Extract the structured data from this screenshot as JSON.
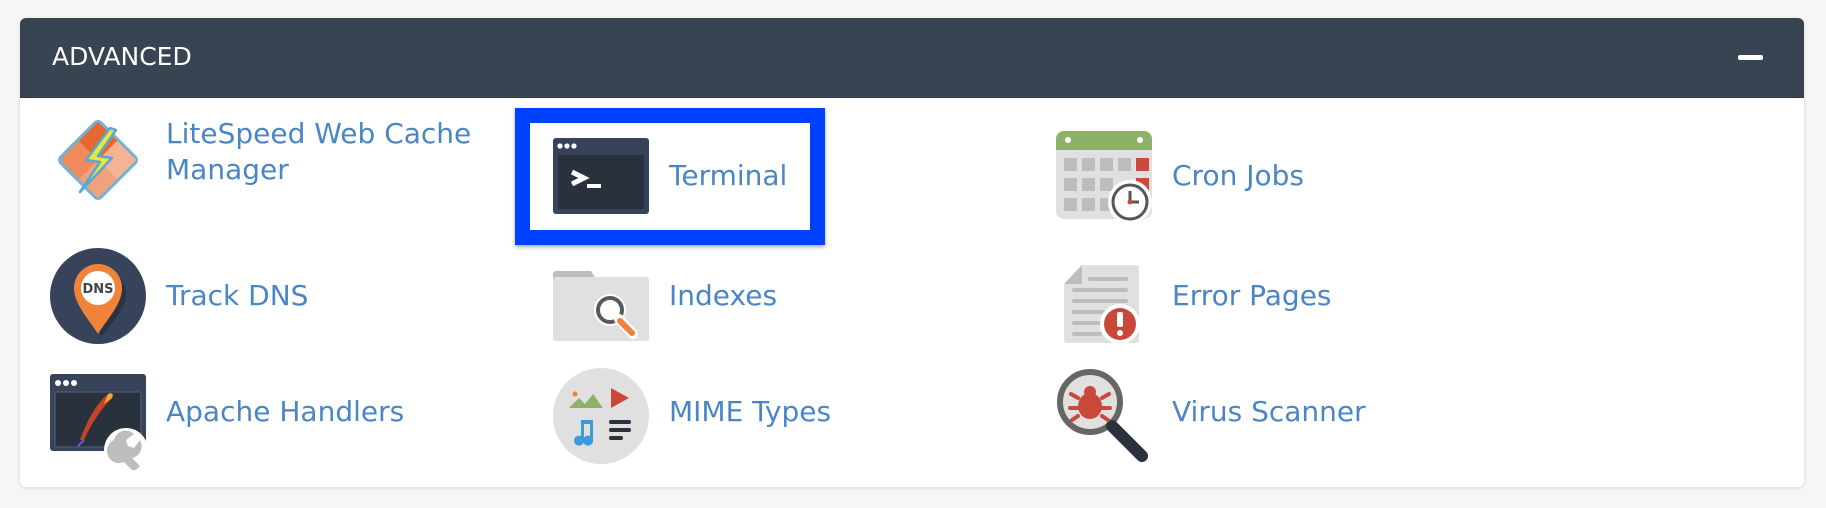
{
  "panel": {
    "title": "ADVANCED",
    "collapse_icon": "minus-icon"
  },
  "highlight": {
    "target": "Terminal",
    "color": "#0041ff"
  },
  "items": [
    {
      "label": "LiteSpeed Web Cache Manager",
      "label_line1": "LiteSpeed Web Cache",
      "label_line2": "Manager",
      "icon": "litespeed-icon"
    },
    {
      "label": "Terminal",
      "icon": "terminal-icon"
    },
    {
      "label": "Cron Jobs",
      "icon": "calendar-clock-icon"
    },
    {
      "label": "Track DNS",
      "icon": "dns-pin-icon"
    },
    {
      "label": "Indexes",
      "icon": "folder-search-icon"
    },
    {
      "label": "Error Pages",
      "icon": "document-error-icon"
    },
    {
      "label": "Apache Handlers",
      "icon": "apache-wrench-icon"
    },
    {
      "label": "MIME Types",
      "icon": "media-types-icon"
    },
    {
      "label": "Virus Scanner",
      "icon": "bug-magnifier-icon"
    }
  ],
  "colors": {
    "header_bg": "#384452",
    "link": "#4a86c5"
  }
}
